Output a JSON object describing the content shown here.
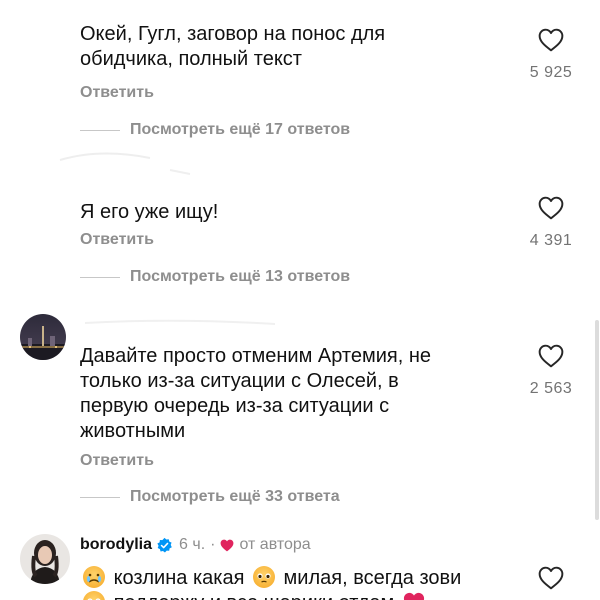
{
  "comments": [
    {
      "text_lines": [
        "Окей, Гугл, заговор на понос для",
        "обидчика, полный текст"
      ],
      "reply_label": "Ответить",
      "likes": "5 925",
      "view_replies": "Посмотреть ещё 17 ответов"
    },
    {
      "text_lines": [
        "Я его уже ищу!"
      ],
      "reply_label": "Ответить",
      "likes": "4 391",
      "view_replies": "Посмотреть ещё 13 ответов"
    },
    {
      "text_lines": [
        "Давайте просто отменим Артемия, не",
        "только из-за ситуации с Олесей, в",
        "первую очередь из-за ситуации с",
        "животными"
      ],
      "reply_label": "Ответить",
      "likes": "2 563",
      "view_replies": "Посмотреть ещё 33 ответа"
    },
    {
      "username": "borodylia",
      "time": "6 ч.",
      "separator": "·",
      "author_tag": "от автора",
      "line1_a": "козлина какая",
      "line1_b": "милая, всегда зови",
      "line2": "поддержу и все шарики отдам"
    }
  ],
  "icons": {
    "like": "heart-outline-icon",
    "verified": "verified-badge-icon",
    "author_like": "red-heart-icon"
  },
  "colors": {
    "muted": "#8e8e8e",
    "verified": "#0095f6",
    "author_heart": "#e0245e"
  }
}
